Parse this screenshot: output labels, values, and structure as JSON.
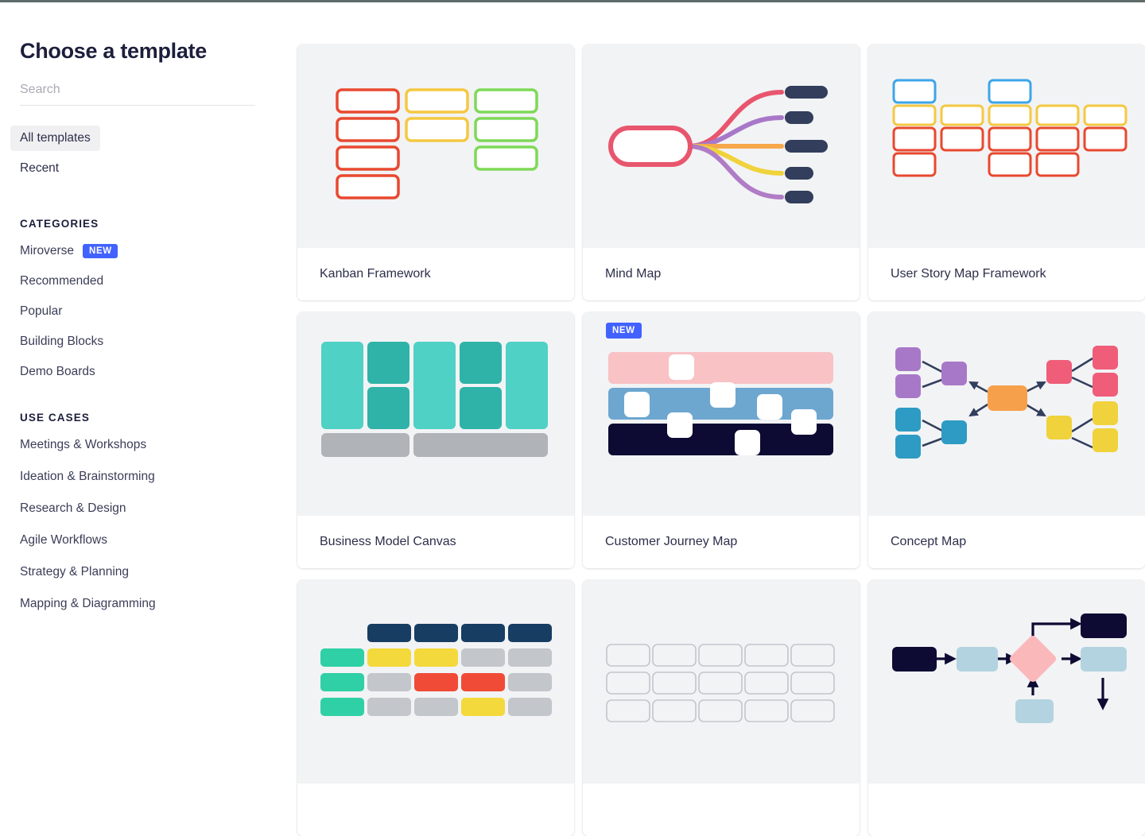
{
  "sidebar": {
    "title": "Choose a template",
    "search": {
      "placeholder": "Search",
      "value": ""
    },
    "nav": [
      {
        "label": "All templates",
        "active": true
      },
      {
        "label": "Recent",
        "active": false
      }
    ],
    "categories_heading": "CATEGORIES",
    "categories": [
      {
        "label": "Miroverse",
        "badge": "NEW"
      },
      {
        "label": "Recommended",
        "badge": ""
      },
      {
        "label": "Popular",
        "badge": ""
      },
      {
        "label": "Building Blocks",
        "badge": ""
      },
      {
        "label": "Demo Boards",
        "badge": ""
      }
    ],
    "use_cases_heading": "USE CASES",
    "use_cases": [
      {
        "label": "Meetings & Workshops"
      },
      {
        "label": "Ideation & Brainstorming"
      },
      {
        "label": "Research & Design"
      },
      {
        "label": "Agile Workflows"
      },
      {
        "label": "Strategy & Planning"
      },
      {
        "label": "Mapping & Diagramming"
      }
    ]
  },
  "templates": [
    {
      "title": "Kanban Framework",
      "badge": "",
      "art": "kanban"
    },
    {
      "title": "Mind Map",
      "badge": "",
      "art": "mindmap"
    },
    {
      "title": "User Story Map Framework",
      "badge": "",
      "art": "userstory"
    },
    {
      "title": "Business Model Canvas",
      "badge": "",
      "art": "bmc"
    },
    {
      "title": "Customer Journey Map",
      "badge": "NEW",
      "art": "journey"
    },
    {
      "title": "Concept Map",
      "badge": "",
      "art": "concept"
    },
    {
      "title": "",
      "badge": "",
      "art": "matrix"
    },
    {
      "title": "",
      "badge": "",
      "art": "emptygrid"
    },
    {
      "title": "",
      "badge": "",
      "art": "flowchart"
    }
  ],
  "colors": {
    "accent_blue": "#4262ff",
    "text_dark": "#1c1f3b",
    "text_body": "#3b3d57",
    "thumb_bg": "#f2f3f5",
    "kanban_red": "#e8492f",
    "kanban_yellow": "#f5c842",
    "kanban_green": "#7ed957",
    "story_blue": "#3da5e8",
    "mind_pink": "#e8566e",
    "mind_purple": "#a878c8",
    "mind_orange": "#f7a84b",
    "mind_yellow": "#f0d23c",
    "mind_navy": "#323e5c",
    "bmc_teal_light": "#4fd1c5",
    "bmc_teal_dark": "#2fb3a8",
    "bmc_gray": "#b0b3b8",
    "journey_pink": "#f9c2c5",
    "journey_blue": "#6da7d0",
    "journey_navy": "#0d0b33",
    "concept_purple": "#a878c8",
    "concept_blue": "#2e9bc4",
    "concept_orange": "#f7a04b",
    "concept_pink": "#ef5d79",
    "concept_yellow": "#f0d23c",
    "matrix_navy": "#173d63",
    "matrix_green": "#2fd0a5",
    "matrix_yellow": "#f4d93c",
    "matrix_red": "#f04b36",
    "matrix_gray": "#c3c6cb",
    "flow_navy": "#0d0b33",
    "flow_lightblue": "#b3d3e0",
    "flow_pink": "#fbb8bb"
  }
}
